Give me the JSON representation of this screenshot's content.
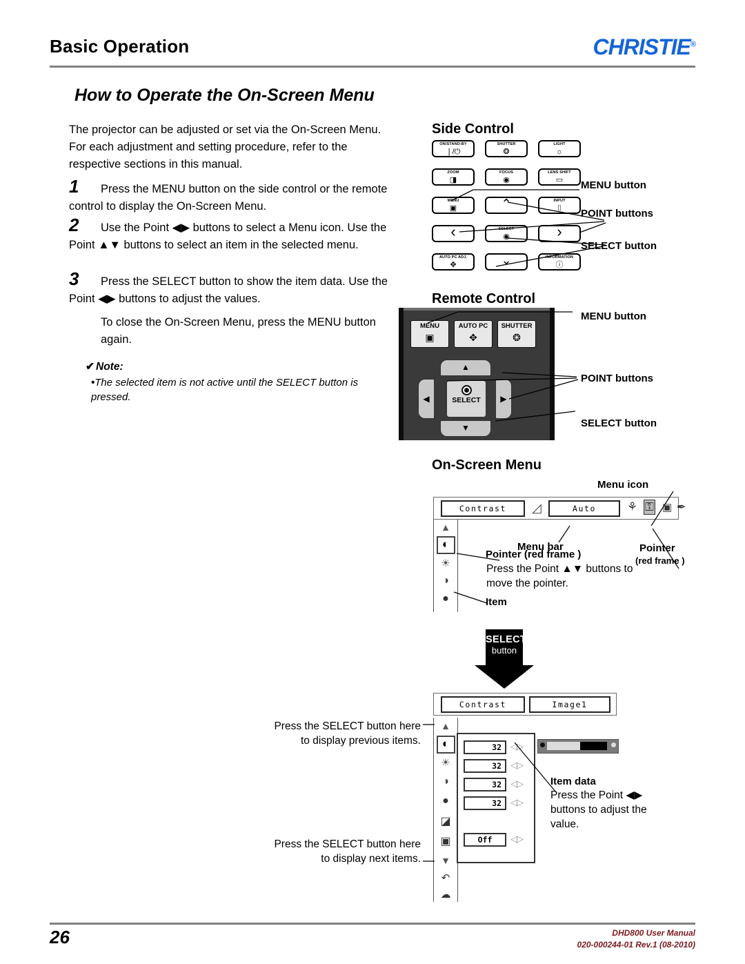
{
  "header": {
    "section_title": "Basic Operation",
    "brand": "CHRISTIE",
    "brand_reg": "®",
    "brand_color": "#1464d7",
    "page_heading": "How to Operate the On-Screen Menu"
  },
  "intro": "The projector can be adjusted or set via the On-Screen Menu. For each adjustment and setting procedure, refer to the respective sections in this manual.",
  "steps": [
    {
      "num": "1",
      "text": "Press the MENU button on the side control or the remote control to display the On-Screen Menu."
    },
    {
      "num": "2",
      "text": "Use the Point ◀▶ buttons to select a Menu icon. Use the Point ▲▼ buttons to select an item in the selected menu."
    },
    {
      "num": "3",
      "text": "Press the SELECT button to show the item data. Use the Point ◀▶ buttons to adjust the values."
    }
  ],
  "closing": "To close the On-Screen Menu, press the MENU button again.",
  "note": {
    "check": "✔",
    "title": "Note:",
    "bullet": "•",
    "text": "The selected item is not active until the SELECT button is pressed."
  },
  "side_control": {
    "title": "Side Control",
    "buttons": [
      {
        "label": "ON/STAND-BY",
        "glyph": "❘/⏻"
      },
      {
        "label": "SHUTTER",
        "glyph": "❂"
      },
      {
        "label": "LIGHT",
        "glyph": "☼"
      },
      {
        "label": "ZOOM",
        "glyph": "◨"
      },
      {
        "label": "FOCUS",
        "glyph": "◉"
      },
      {
        "label": "LENS SHIFT",
        "glyph": "▭"
      },
      {
        "label": "MENU",
        "glyph": "▣"
      },
      {
        "label": "",
        "glyph": "⌃"
      },
      {
        "label": "INPUT",
        "glyph": "⌷"
      },
      {
        "label": "",
        "glyph": "‹"
      },
      {
        "label": "SELECT",
        "glyph": "◉"
      },
      {
        "label": "",
        "glyph": "›"
      },
      {
        "label": "AUTO PC ADJ.",
        "glyph": "✥"
      },
      {
        "label": "",
        "glyph": "⌄"
      },
      {
        "label": "INFORMATION",
        "glyph": "ⓘ"
      }
    ],
    "callouts": {
      "menu": "MENU button",
      "point": "POINT buttons",
      "select": "SELECT button"
    }
  },
  "remote_control": {
    "title": "Remote Control",
    "buttons": [
      {
        "label": "MENU",
        "glyph": "▣"
      },
      {
        "label": "AUTO PC",
        "glyph": "✥"
      },
      {
        "label": "SHUTTER",
        "glyph": "❂"
      }
    ],
    "select_label": "SELECT",
    "callouts": {
      "menu": "MENU button",
      "point": "POINT buttons",
      "select": "SELECT button"
    }
  },
  "on_screen_menu": {
    "title": "On-Screen Menu",
    "menu_bar_top": {
      "left_item": "Contrast",
      "right_item": "Auto"
    },
    "callouts": {
      "menu_icon": "Menu icon",
      "menu_bar": "Menu bar",
      "pointer_red_frame": "Pointer (red frame )",
      "pointer_right_l1": "Pointer",
      "pointer_right_l2": "(red frame )",
      "pointer_note": "Press the Point ▲▼ buttons to move the pointer.",
      "item": "Item"
    },
    "select_arrow": {
      "line1": "SELECT",
      "line2": "button"
    },
    "menu_bar_bottom": {
      "left_item": "Contrast",
      "right_item": "Image1"
    },
    "item_values": [
      "32",
      "32",
      "32",
      "32"
    ],
    "toggle_value": "Off",
    "arrow_glyph": "◁▷",
    "item_data": {
      "title": "Item data",
      "text": "Press the Point ◀▶ buttons to adjust the value."
    },
    "prev_caption": "Press the SELECT button here to display previous items.",
    "next_caption": "Press the SELECT button here to display next items."
  },
  "footer": {
    "page_number": "26",
    "manual": "DHD800 User Manual",
    "doc_id": "020-000244-01 Rev.1 (08-2010)",
    "color": "#7c1a1f"
  }
}
